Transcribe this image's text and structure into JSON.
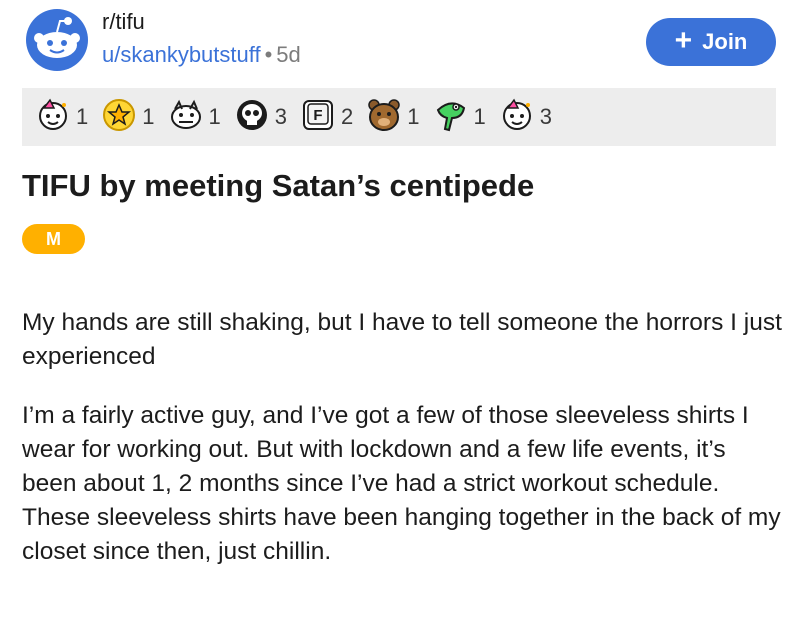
{
  "post": {
    "subreddit": "r/tifu",
    "author": "u/skankybutstuff",
    "age": "5d",
    "join_label": "Join",
    "title": "TIFU by meeting Satan’s centipede",
    "flair": "M",
    "paragraphs": [
      "My hands are still shaking, but I have to tell someone the horrors I just experienced",
      "I’m a fairly active guy, and I’ve got a few of those sleeveless shirts I wear for working out. But with lockdown and a few life events, it’s been about 1, 2 months since I’ve had a strict workout schedule. These sleeveless shirts have been hanging together in the back of my closet since then, just chillin."
    ]
  },
  "awards": [
    {
      "icon": "party-face-award-icon",
      "count": "1"
    },
    {
      "icon": "gold-award-icon",
      "count": "1"
    },
    {
      "icon": "dragon-face-award-icon",
      "count": "1"
    },
    {
      "icon": "skull-award-icon",
      "count": "3"
    },
    {
      "icon": "f-key-award-icon",
      "count": "2"
    },
    {
      "icon": "bear-award-icon",
      "count": "1"
    },
    {
      "icon": "green-creature-award-icon",
      "count": "1"
    },
    {
      "icon": "party-face-award-icon",
      "count": "3"
    }
  ],
  "colors": {
    "accent": "#3b72d8",
    "flair": "#ffb000",
    "awards_bar": "#ededed"
  }
}
